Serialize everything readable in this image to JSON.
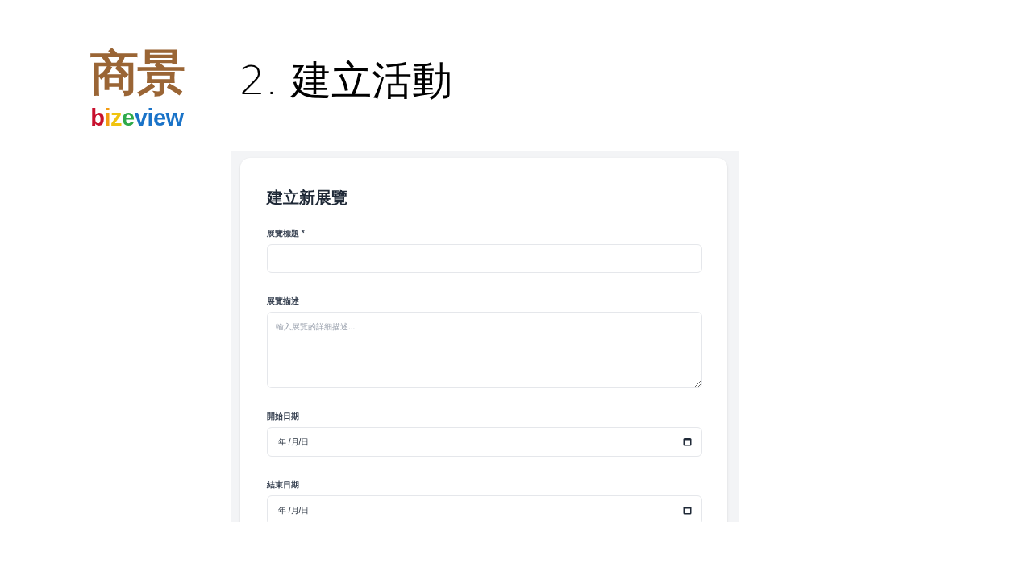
{
  "logo": {
    "mark": "商景",
    "letters": [
      {
        "text": "b",
        "color": "#c8102e"
      },
      {
        "text": "i",
        "color": "#f39c12"
      },
      {
        "text": "z",
        "color": "#f1c40f"
      },
      {
        "text": "e",
        "color": "#2eaa4a"
      },
      {
        "text": "v",
        "color": "#1a73c8"
      },
      {
        "text": "i",
        "color": "#1a73c8"
      },
      {
        "text": "e",
        "color": "#1a73c8"
      },
      {
        "text": "w",
        "color": "#1a73c8"
      }
    ]
  },
  "slide_title": "2. 建立活動",
  "form": {
    "title": "建立新展覽",
    "fields": [
      {
        "kind": "text",
        "label": "展覽標題 *"
      },
      {
        "kind": "textarea",
        "label": "展覽描述",
        "placeholder": "輸入展覽的詳細描述..."
      },
      {
        "kind": "date",
        "label": "開始日期",
        "value": "年 /月/日"
      },
      {
        "kind": "date",
        "label": "結束日期",
        "value": "年 /月/日"
      }
    ]
  }
}
